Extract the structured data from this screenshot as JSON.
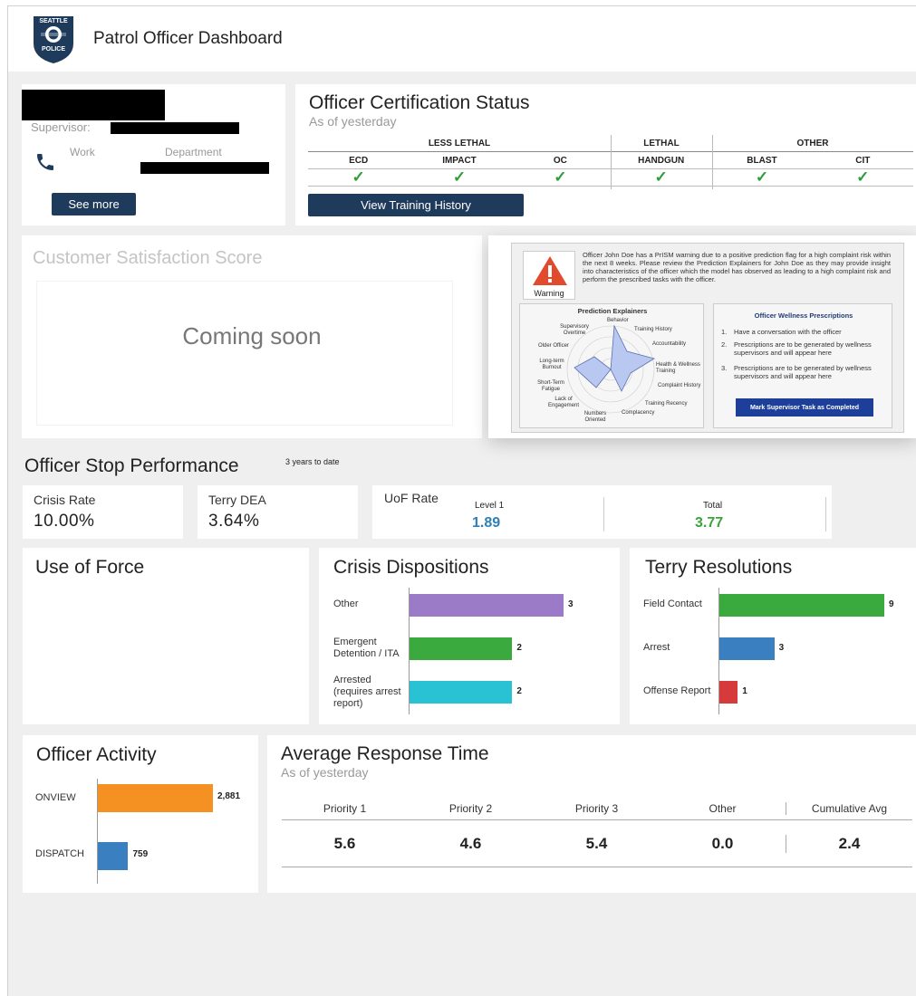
{
  "header": {
    "title": "Patrol Officer Dashboard",
    "badge_top": "SEATTLE",
    "badge_bottom": "POLICE"
  },
  "profile": {
    "supervisor_label": "Supervisor:",
    "work_label": "Work",
    "department_label": "Department",
    "see_more": "See more"
  },
  "certification": {
    "title": "Officer Certification Status",
    "subtitle": "As of yesterday",
    "groups": [
      "LESS LETHAL",
      "LETHAL",
      "OTHER"
    ],
    "columns": [
      "ECD",
      "IMPACT",
      "OC",
      "HANDGUN",
      "BLAST",
      "CIT"
    ],
    "check": "✓",
    "button": "View Training History"
  },
  "satisfaction": {
    "title": "Customer Satisfaction Score",
    "placeholder": "Coming soon"
  },
  "prism": {
    "warning_label": "Warning",
    "message": "Officer John Doe has a PrISM warning due to a positive prediction flag for a high complaint risk within the next 8 weeks. Please review the Prediction Explainers for John Doe as they may provide insight into characteristics of the officer which the model has observed as leading to a high complaint risk and perform the prescribed tasks with the officer.",
    "explainers_title": "Prediction Explainers",
    "radar_labels": [
      "Behavior",
      "Training History",
      "Accountability",
      "Health & Wellness Training",
      "Complaint History",
      "Training Recency",
      "Complacency",
      "Numbers Oriented",
      "Lack of Engagement",
      "Short-Term Fatigue",
      "Long-term Burnout",
      "Older Officer",
      "Supervisory Overtime"
    ],
    "prescriptions_title": "Officer Wellness Prescriptions",
    "prescriptions": [
      "Have a conversation with the officer",
      "Prescriptions are to be generated by wellness supervisors and will appear here",
      "Prescriptions are to be generated by wellness supervisors and will appear here"
    ],
    "task_button": "Mark Supervisor Task as Completed"
  },
  "stop_performance": {
    "title": "Officer Stop Performance",
    "note": "3 years to date",
    "crisis_rate_label": "Crisis Rate",
    "crisis_rate_value": "10.00%",
    "terry_dea_label": "Terry DEA",
    "terry_dea_value": "3.64%",
    "uof_label": "UoF Rate",
    "level1_label": "Level 1",
    "level1_value": "1.89",
    "total_label": "Total",
    "total_value": "3.77"
  },
  "use_of_force": {
    "title": "Use of Force"
  },
  "chart_data": [
    {
      "type": "bar",
      "title": "Crisis Dispositions",
      "orientation": "horizontal",
      "categories": [
        "Other",
        "Emergent Detention / ITA",
        "Arrested (requires arrest report)"
      ],
      "values": [
        3,
        2,
        2
      ],
      "colors": [
        "#9b7ac8",
        "#3aaa3f",
        "#29c2d4"
      ]
    },
    {
      "type": "bar",
      "title": "Terry Resolutions",
      "orientation": "horizontal",
      "categories": [
        "Field Contact",
        "Arrest",
        "Offense Report"
      ],
      "values": [
        9,
        3,
        1
      ],
      "colors": [
        "#3aaa3f",
        "#3a80c0",
        "#d63a3a"
      ]
    },
    {
      "type": "bar",
      "title": "Officer Activity",
      "orientation": "horizontal",
      "categories": [
        "ONVIEW",
        "DISPATCH"
      ],
      "values": [
        2881,
        759
      ],
      "value_labels": [
        "2,881",
        "759"
      ],
      "colors": [
        "#f59122",
        "#3a80c0"
      ]
    },
    {
      "type": "table",
      "title": "Average Response Time",
      "subtitle": "As of yesterday",
      "columns": [
        "Priority 1",
        "Priority 2",
        "Priority 3",
        "Other",
        "Cumulative Avg"
      ],
      "values": [
        "5.6",
        "4.6",
        "5.4",
        "0.0",
        "2.4"
      ]
    }
  ],
  "colors": {
    "button_navy": "#1f3b5c",
    "check_green": "#2e9c3a",
    "level1_blue": "#2f7fb8",
    "total_green": "#3aa43a",
    "warning_red": "#e24a2e"
  }
}
